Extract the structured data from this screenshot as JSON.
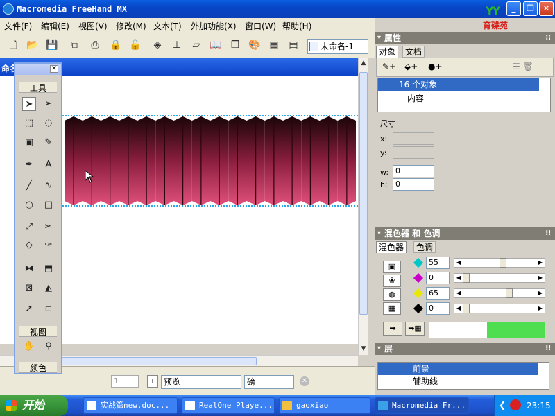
{
  "window": {
    "title": "Macromedia FreeHand MX"
  },
  "logo": {
    "brand": "YY",
    "text": "育碟苑"
  },
  "menu": [
    "文件(F)",
    "编辑(E)",
    "视图(V)",
    "修改(M)",
    "文本(T)",
    "外加功能(X)",
    "窗口(W)",
    "帮助(H)"
  ],
  "toolbar": {
    "document_name": "未命名-1"
  },
  "doc_window": {
    "title": "命名"
  },
  "tools": {
    "title": "工具",
    "view_title": "视图",
    "color_title": "颜色"
  },
  "status": {
    "view_mode": "预览",
    "units": "磅",
    "page": "1"
  },
  "properties": {
    "title": "属性",
    "tabs": [
      "对象",
      "文档"
    ],
    "object_count": "16 个对象",
    "content_label": "内容",
    "dimensions_label": "尺寸",
    "x_label": "x:",
    "y_label": "y:",
    "w_label": "w:",
    "h_label": "h:",
    "w_value": "0",
    "h_value": "0"
  },
  "mixer": {
    "title": "混色器 和 色调",
    "tabs": [
      "混色器",
      "色调"
    ],
    "values": [
      {
        "value": "55",
        "color": "#00c8c8",
        "level": 0.55
      },
      {
        "value": "0",
        "color": "#c800c8",
        "level": 0.0
      },
      {
        "value": "65",
        "color": "#e8e800",
        "level": 0.65
      },
      {
        "value": "0",
        "color": "#000000",
        "level": 0.0
      }
    ],
    "preview_color": "#4fde4f"
  },
  "layers": {
    "title": "层",
    "items": [
      "前景",
      "辅助线"
    ]
  },
  "taskbar": {
    "start_label": "开始",
    "tasks": [
      "实战篇new.doc...",
      "RealOne Playe...",
      "gaoxiao",
      "Macromedia Fr..."
    ],
    "clock": "23:15"
  }
}
